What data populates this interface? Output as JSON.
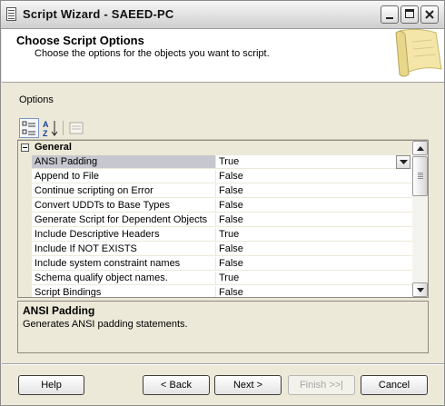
{
  "window": {
    "title": "Script Wizard - SAEED-PC"
  },
  "header": {
    "title": "Choose Script Options",
    "subtitle": "Choose the options for the objects you want to script."
  },
  "options": {
    "label": "Options",
    "category": "General",
    "properties": [
      {
        "name": "ANSI Padding",
        "value": "True"
      },
      {
        "name": "Append to File",
        "value": "False"
      },
      {
        "name": "Continue scripting on Error",
        "value": "False"
      },
      {
        "name": "Convert UDDTs to Base Types",
        "value": "False"
      },
      {
        "name": "Generate Script for Dependent Objects",
        "value": "False"
      },
      {
        "name": "Include Descriptive Headers",
        "value": "True"
      },
      {
        "name": "Include If NOT EXISTS",
        "value": "False"
      },
      {
        "name": "Include system constraint names",
        "value": "False"
      },
      {
        "name": "Schema qualify object names.",
        "value": "True"
      },
      {
        "name": "Script Bindings",
        "value": "False"
      }
    ]
  },
  "description": {
    "title": "ANSI Padding",
    "text": "Generates ANSI padding statements."
  },
  "buttons": {
    "help": "Help",
    "back": "< Back",
    "next": "Next >",
    "finish": "Finish >>|",
    "cancel": "Cancel"
  }
}
